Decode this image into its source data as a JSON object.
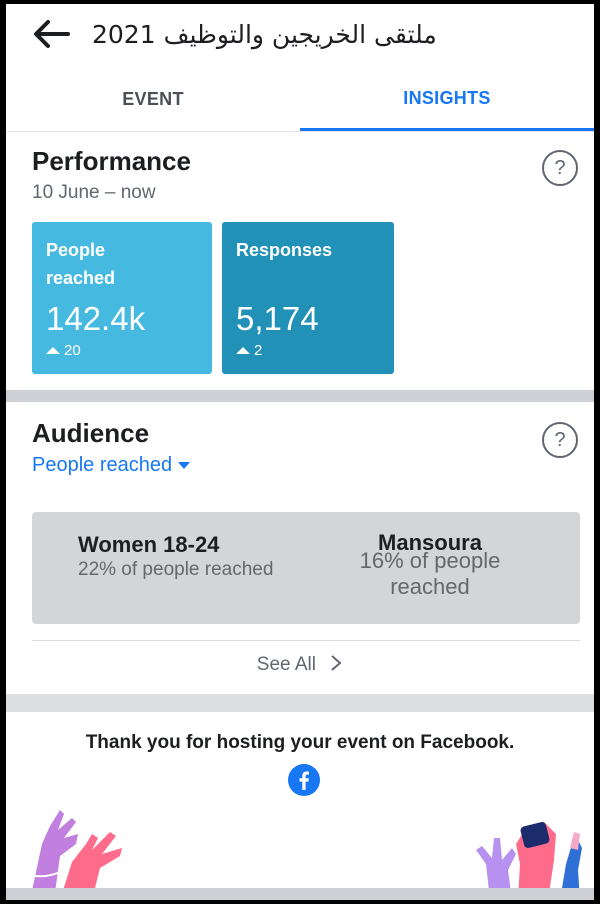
{
  "header": {
    "title": "ملتقى الخريجين والتوظيف 2021",
    "back_icon": "back-arrow-icon"
  },
  "tabs": [
    {
      "label": "EVENT",
      "active": false
    },
    {
      "label": "INSIGHTS",
      "active": true
    }
  ],
  "performance": {
    "title": "Performance",
    "help_symbol": "?",
    "date_range": "10 June – now",
    "tiles": [
      {
        "label": "People reached",
        "value": "142.4k",
        "delta": "20",
        "color": "#46b9e1"
      },
      {
        "label": "Responses",
        "value": "5,174",
        "delta": "2",
        "color": "#2191b7"
      }
    ]
  },
  "audience": {
    "title": "Audience",
    "help_symbol": "?",
    "filter_label": "People reached",
    "top": [
      {
        "name": "Women 18-24",
        "detail": "22% of people reached"
      },
      {
        "name": "Mansoura",
        "detail": "16% of people reached"
      }
    ],
    "see_all": "See All"
  },
  "footer": {
    "thanks": "Thank you for hosting your event on Facebook.",
    "brand_icon": "facebook-logo-icon"
  },
  "colors": {
    "accent": "#1877f2",
    "tile_light": "#46b9e1",
    "tile_dark": "#2191b7"
  }
}
